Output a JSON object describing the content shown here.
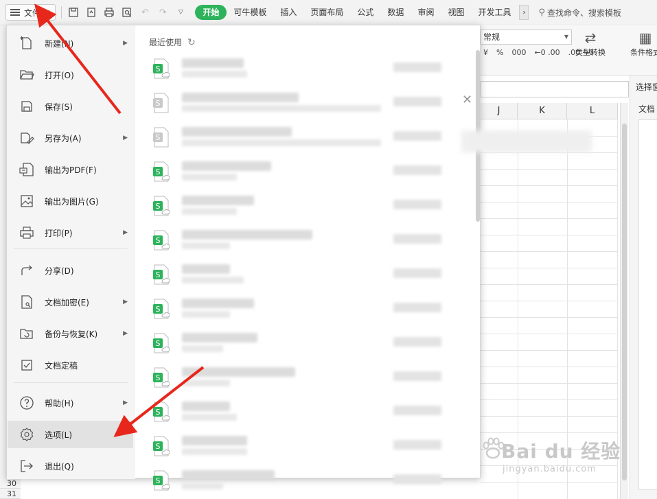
{
  "toolbar": {
    "file_label": "文件",
    "tabs": [
      "开始",
      "可牛模板",
      "插入",
      "页面布局",
      "公式",
      "数据",
      "审阅",
      "视图",
      "开发工具"
    ],
    "search_label": "查找命令、搜索模板"
  },
  "ribbon": {
    "format_value": "常规",
    "type_convert": "类型转换",
    "cond_format": "条件格式",
    "num_symbols": [
      "¥",
      "%",
      "000",
      "←0 .00",
      ".00 →0"
    ]
  },
  "columns": [
    "J",
    "K",
    "L"
  ],
  "rownums": [
    "30",
    "31"
  ],
  "right_panel": {
    "line1": "选择窗",
    "line2": "文档"
  },
  "menu": {
    "items": [
      {
        "label": "新建(N)",
        "icon": "new-file-icon",
        "arrow": true
      },
      {
        "label": "打开(O)",
        "icon": "open-folder-icon",
        "arrow": false
      },
      {
        "label": "保存(S)",
        "icon": "save-icon",
        "arrow": false
      },
      {
        "label": "另存为(A)",
        "icon": "save-as-icon",
        "arrow": true
      },
      {
        "label": "输出为PDF(F)",
        "icon": "pdf-export-icon",
        "arrow": false
      },
      {
        "label": "输出为图片(G)",
        "icon": "image-export-icon",
        "arrow": false
      },
      {
        "label": "打印(P)",
        "icon": "printer-icon",
        "arrow": true
      },
      {
        "label": "分享(D)",
        "icon": "share-icon",
        "arrow": false
      },
      {
        "label": "文档加密(E)",
        "icon": "encrypt-icon",
        "arrow": true
      },
      {
        "label": "备份与恢复(K)",
        "icon": "backup-icon",
        "arrow": true
      },
      {
        "label": "文档定稿",
        "icon": "finalize-icon",
        "arrow": false
      },
      {
        "label": "帮助(H)",
        "icon": "help-icon",
        "arrow": true
      },
      {
        "label": "选项(L)",
        "icon": "gear-icon",
        "arrow": false
      },
      {
        "label": "退出(Q)",
        "icon": "exit-icon",
        "arrow": false
      }
    ],
    "recent_title": "最近使用",
    "recent_count": 13
  },
  "watermark": {
    "main": "Bai du 经验",
    "sub": "jingyan.baidu.com"
  },
  "colors": {
    "accent": "#2db35b",
    "arrow": "#e8271c"
  }
}
